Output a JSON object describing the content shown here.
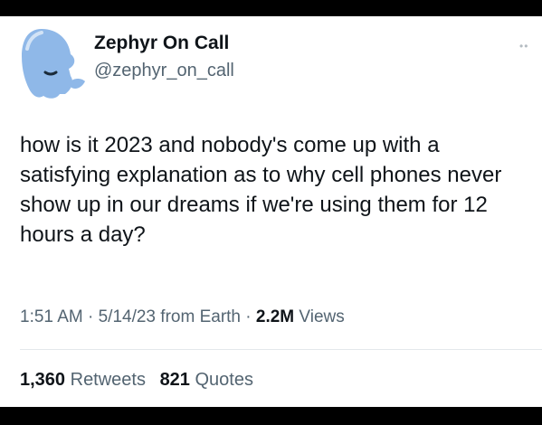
{
  "author": {
    "display_name": "Zephyr On Call",
    "handle": "@zephyr_on_call",
    "avatar_icon": "ghost-icon"
  },
  "more_icon": "more-options-icon",
  "tweet": {
    "text": "how is it 2023 and nobody's come up with a satisfying explanation as to why cell phones never show up in our dreams if we're using them for 12 hours a day?"
  },
  "meta": {
    "time": "1:51 AM",
    "separator_1": " · ",
    "date": "5/14/23",
    "source": " from Earth",
    "separator_2": " · ",
    "views_count": "2.2M",
    "views_label": " Views"
  },
  "stats": {
    "retweets_count": "1,360",
    "retweets_label": " Retweets",
    "quotes_count": "821",
    "quotes_label": " Quotes"
  },
  "colors": {
    "text_primary": "#0f1419",
    "text_secondary": "#536471",
    "avatar_blue": "#8fb8e8",
    "divider": "#e4e8eb"
  }
}
